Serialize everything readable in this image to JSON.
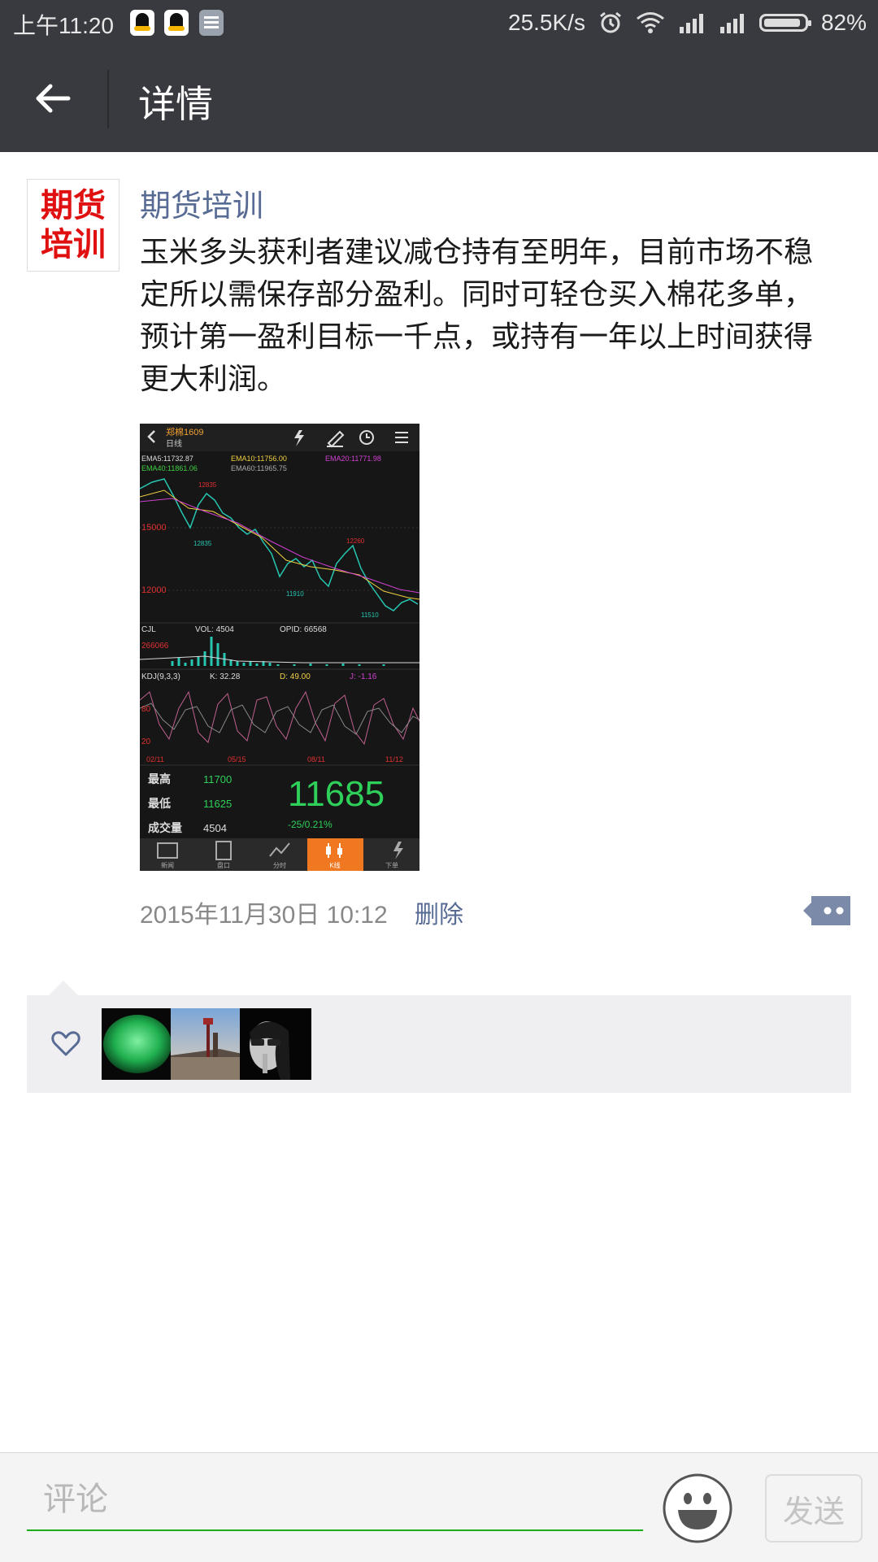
{
  "status_bar": {
    "time": "上午11:20",
    "net_speed": "25.5K/s",
    "battery": "82%"
  },
  "header": {
    "title": "详情"
  },
  "post": {
    "avatar_text_line1": "期货",
    "avatar_text_line2": "培训",
    "author": "期货培训",
    "content": "玉米多头获利者建议减仓持有至明年，目前市场不稳定所以需保存部分盈利。同时可轻仓买入棉花多单，预计第一盈利目标一千点，或持有一年以上时间获得更大利润。",
    "timestamp": "2015年11月30日 10:12",
    "delete_label": "删除"
  },
  "screenshot": {
    "symbol": "郑棉1609",
    "period": "日线",
    "ema5": "EMA5:11732.87",
    "ema10": "EMA10:11756.00",
    "ema20": "EMA20:11771.98",
    "ema40": "EMA40:11861.06",
    "ema60": "EMA60:11965.75",
    "axis_15000": "15000",
    "axis_12000": "12000",
    "lbl_12835": "12835",
    "lbl_11910": "11910",
    "lbl_11510": "11510",
    "lbl_12260": "12260",
    "cjl": "CJL",
    "vol": "VOL: 4504",
    "opid": "OPID: 66568",
    "vol_axis": "266066",
    "kdj": "KDJ(9,3,3)",
    "k": "K: 32.28",
    "d": "D: 49.00",
    "j": "J: -1.16",
    "high_label": "最高",
    "high_value": "11700",
    "low_label": "最低",
    "low_value": "11625",
    "volume_label": "成交量",
    "volume_value": "4504",
    "price": "11685",
    "change": "-25/0.21%",
    "dates": [
      "02/11",
      "05/15",
      "08/11",
      "11/12"
    ],
    "tabs": [
      "新闻",
      "盘口",
      "分时",
      "K线",
      "下单"
    ]
  },
  "likes": {
    "count": 3
  },
  "comment_bar": {
    "placeholder": "评论",
    "send_label": "发送"
  }
}
